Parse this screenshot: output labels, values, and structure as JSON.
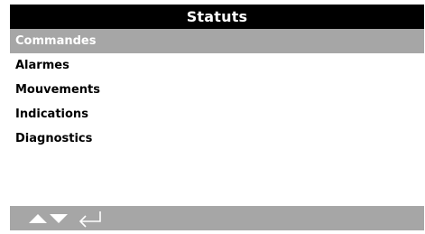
{
  "header": {
    "title": "Statuts"
  },
  "menu": {
    "items": [
      {
        "label": "Commandes",
        "selected": true
      },
      {
        "label": "Alarmes",
        "selected": false
      },
      {
        "label": "Mouvements",
        "selected": false
      },
      {
        "label": "Indications",
        "selected": false
      },
      {
        "label": "Diagnostics",
        "selected": false
      }
    ]
  },
  "softkeys": {
    "icons": [
      "up-arrow-icon",
      "down-arrow-icon",
      "enter-return-icon"
    ]
  },
  "colors": {
    "title_bar": "#000000",
    "selection": "#a6a6a6",
    "softkey_bar": "#a6a6a6",
    "icon": "#ffffff"
  }
}
